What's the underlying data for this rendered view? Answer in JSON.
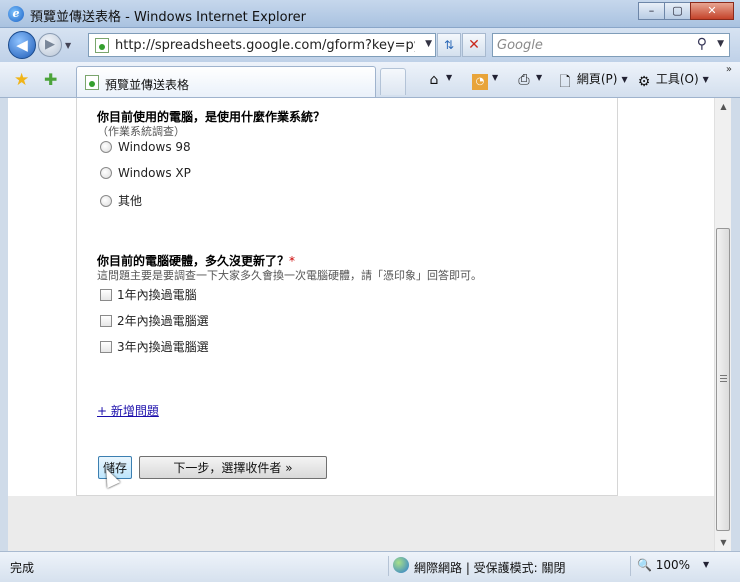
{
  "window": {
    "title": "預覽並傳送表格 - Windows Internet Explorer",
    "minimize": "–",
    "maximize": "▢",
    "close": "✕"
  },
  "address_bar": {
    "url": "http://spreadsheets.google.com/gform?key=pytbFzE",
    "search_placeholder": "Google"
  },
  "tab": {
    "label": "預覽並傳送表格"
  },
  "commands": {
    "page": "網頁(P)",
    "tools": "工具(O)"
  },
  "form": {
    "question1": {
      "title": "你目前使用的電腦，是使用什麼作業系統？",
      "help": "（作業系統調查）",
      "options": [
        "Windows 98",
        "Windows XP",
        "其他"
      ]
    },
    "question2": {
      "title": "你目前的電腦硬體，多久沒更新了？",
      "required_mark": "*",
      "help": "這問題主要是要調查一下大家多久會換一次電腦硬體，請「憑印象」回答即可。",
      "options": [
        "1年內換過電腦",
        "2年內換過電腦選",
        "3年內換過電腦選"
      ]
    },
    "add_question": "+ 新增問題",
    "save_button": "儲存",
    "next_button": "下一步，選擇收件者 »"
  },
  "status_bar": {
    "text": "完成",
    "zone": "網際網路 | 受保護模式: 關閉",
    "zoom": "100%"
  }
}
